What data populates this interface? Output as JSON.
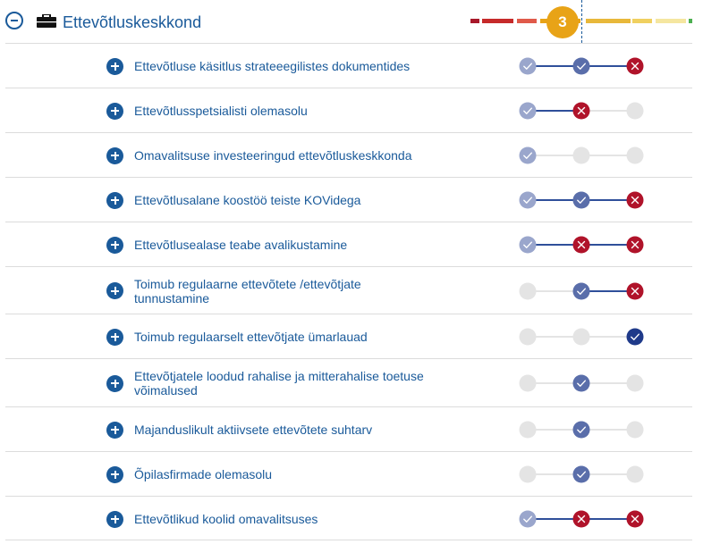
{
  "section": {
    "title": "Ettevõtluskeskkond",
    "score": "3"
  },
  "scale_colors": [
    "#a8182a",
    "#c62a2a",
    "#e05a4a",
    "#e8a317",
    "#e8b83a",
    "#f0d060",
    "#f5e6a0",
    "#4caf50"
  ],
  "status_colors": {
    "check-light": "#9aa6cc",
    "check-medium": "#5a6eaa",
    "check-dark": "#1f3a8a",
    "cross": "#b0132a",
    "empty": "#e4e4e4"
  },
  "rows": [
    {
      "label": "Ettevõtluse käsitlus strateeegilistes dokumentides",
      "states": [
        "check-light",
        "check-medium",
        "cross"
      ]
    },
    {
      "label": "Ettevõtlusspetsialisti olemasolu",
      "states": [
        "check-light",
        "cross",
        "empty"
      ]
    },
    {
      "label": "Omavalitsuse investeeringud ettevõtluskeskkonda",
      "states": [
        "check-light",
        "empty",
        "empty"
      ]
    },
    {
      "label": "Ettevõtlusalane koostöö teiste KOVidega",
      "states": [
        "check-light",
        "check-medium",
        "cross"
      ]
    },
    {
      "label": "Ettevõtlusealase teabe avalikustamine",
      "states": [
        "check-light",
        "cross",
        "cross"
      ]
    },
    {
      "label": "Toimub regulaarne ettevõtete /ettevõtjate tunnustamine",
      "states": [
        "empty",
        "check-medium",
        "cross"
      ]
    },
    {
      "label": "Toimub regulaarselt ettevõtjate ümarlauad",
      "states": [
        "empty",
        "empty",
        "check-dark"
      ]
    },
    {
      "label": "Ettevõtjatele loodud rahalise ja mitterahalise toetuse võimalused",
      "states": [
        "empty",
        "check-medium",
        "empty"
      ]
    },
    {
      "label": "Majanduslikult aktiivsete ettevõtete suhtarv",
      "states": [
        "empty",
        "check-medium",
        "empty"
      ]
    },
    {
      "label": "Õpilasfirmade olemasolu",
      "states": [
        "empty",
        "check-medium",
        "empty"
      ]
    },
    {
      "label": "Ettevõtlikud koolid omavalitsuses",
      "states": [
        "check-light",
        "cross",
        "cross"
      ]
    }
  ]
}
